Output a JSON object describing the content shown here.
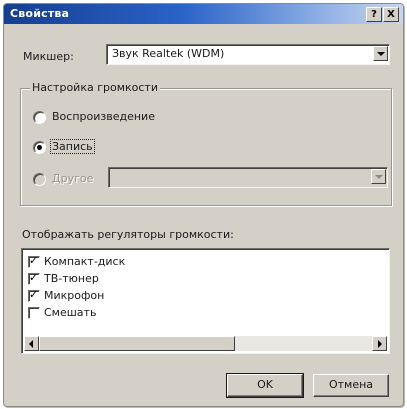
{
  "window": {
    "title": "Свойства",
    "help_glyph": "?",
    "close_glyph": "X"
  },
  "mixer": {
    "label": "Микшер:",
    "selected": "Звук Realtek (WDM)"
  },
  "volume_settings": {
    "group_title": "Настройка громкости",
    "options": [
      {
        "label": "Воспроизведение",
        "selected": false,
        "enabled": true
      },
      {
        "label": "Запись",
        "selected": true,
        "enabled": true
      },
      {
        "label": "Другое",
        "selected": false,
        "enabled": false
      }
    ],
    "other_combo_value": ""
  },
  "controls": {
    "label": "Отображать регуляторы громкости:",
    "items": [
      {
        "label": "Компакт-диск",
        "checked": true
      },
      {
        "label": "ТВ-тюнер",
        "checked": true
      },
      {
        "label": "Микрофон",
        "checked": true
      },
      {
        "label": "Смешать",
        "checked": false
      }
    ],
    "check_glyph": "✓"
  },
  "buttons": {
    "ok": "OK",
    "cancel": "Отмена"
  }
}
